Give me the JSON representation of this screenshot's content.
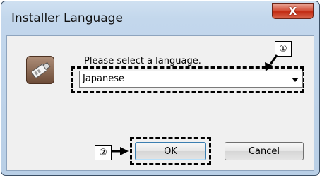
{
  "window": {
    "title": "Installer Language",
    "close_label": "X"
  },
  "dialog": {
    "icon": "installer-icon",
    "prompt": "Please select a language.",
    "language_select": {
      "value": "Japanese"
    },
    "buttons": {
      "ok": "OK",
      "cancel": "Cancel"
    }
  },
  "callouts": {
    "one": "①",
    "two": "②"
  },
  "colors": {
    "title_bar": "#c3d7ec",
    "close_button": "#c22a12",
    "dialog_bg": "#f0f0f0",
    "ok_focus": "#3c7fb1"
  }
}
